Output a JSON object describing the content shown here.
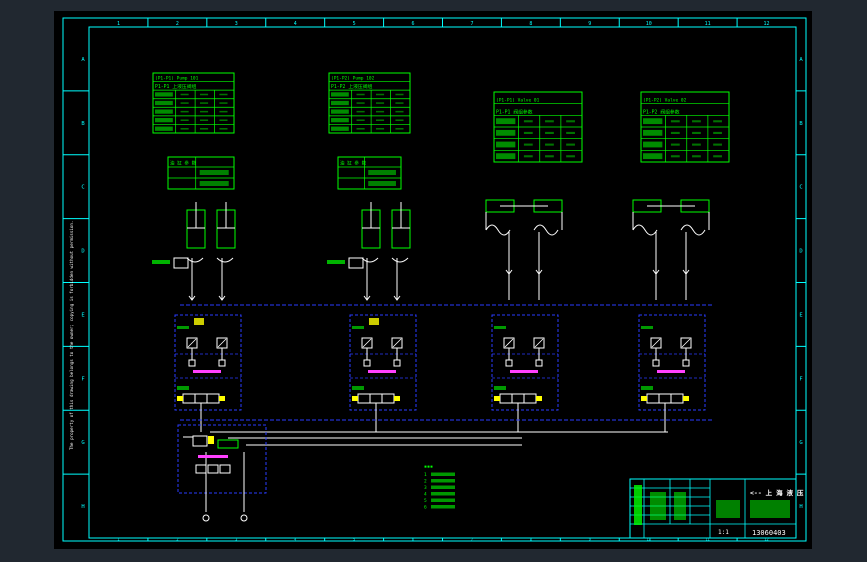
{
  "colors": {
    "viewport_bg": "#212830",
    "sheet_bg": "#000000",
    "frame": "#00ffff",
    "block": "#00ff00",
    "hydraulic": "#ffffff",
    "bus": "#2a3cff",
    "accent_red": "#ff3030",
    "accent_yellow": "#ffff00",
    "accent_magenta": "#ff40ff"
  },
  "border": {
    "top_numbers": [
      "1",
      "2",
      "3",
      "4",
      "5",
      "6",
      "7",
      "8",
      "9",
      "10",
      "11",
      "12"
    ],
    "side_letters": [
      "A",
      "B",
      "C",
      "D",
      "E",
      "F",
      "G",
      "H"
    ]
  },
  "table_blocks": [
    {
      "title": "(P1-P1) Pump 101",
      "subtitle": "P1-P1 上液压阀组"
    },
    {
      "title": "(P1-P2) Pump 102",
      "subtitle": "P1-P2 上液压阀组"
    },
    {
      "title": "(P1-P1) Valve 01",
      "subtitle": "P1-P1 阀组参数"
    },
    {
      "title": "(P1-P2) Valve 02",
      "subtitle": "P1-P2 阀组参数"
    }
  ],
  "small_blocks": [
    {
      "title": "油 缸 参 数"
    },
    {
      "title": "油 缸 参 数"
    }
  ],
  "legend": {
    "items": [
      "1",
      "2",
      "3",
      "4",
      "5",
      "6"
    ]
  },
  "title_block": {
    "company": "<-- 上 海 液 压",
    "drawing_number": "13060403",
    "scale": "1:1"
  },
  "left_note": "The property of this drawing belongs to the owner; copying is forbidden without permission."
}
